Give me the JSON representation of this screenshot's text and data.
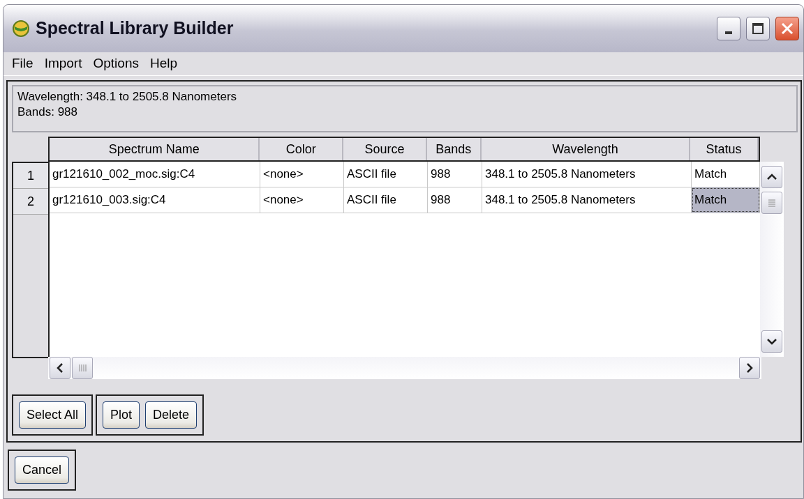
{
  "window": {
    "title": "Spectral Library Builder"
  },
  "menu": [
    "File",
    "Import",
    "Options",
    "Help"
  ],
  "info": [
    "Wavelength: 348.1 to 2505.8 Nanometers",
    "Bands: 988"
  ],
  "table": {
    "columns": [
      "Spectrum Name",
      "Color",
      "Source",
      "Bands",
      "Wavelength",
      "Status"
    ],
    "rows": [
      {
        "number": "1",
        "cells": [
          {
            "text": "gr121610_002_moc.sig:C4",
            "selected": false
          },
          {
            "text": "<none>",
            "selected": false
          },
          {
            "text": "ASCII file",
            "selected": false
          },
          {
            "text": "988",
            "selected": false
          },
          {
            "text": "348.1 to 2505.8 Nanometers",
            "selected": false
          },
          {
            "text": "Match",
            "selected": false
          }
        ]
      },
      {
        "number": "2",
        "cells": [
          {
            "text": "gr121610_003.sig:C4",
            "selected": false
          },
          {
            "text": "<none>",
            "selected": false
          },
          {
            "text": "ASCII file",
            "selected": false
          },
          {
            "text": "988",
            "selected": false
          },
          {
            "text": "348.1 to 2505.8 Nanometers",
            "selected": false
          },
          {
            "text": "Match",
            "selected": true
          }
        ]
      }
    ]
  },
  "button_groups": [
    [
      "Select All"
    ],
    [
      "Plot",
      "Delete"
    ]
  ],
  "footer_buttons": [
    "Cancel"
  ]
}
